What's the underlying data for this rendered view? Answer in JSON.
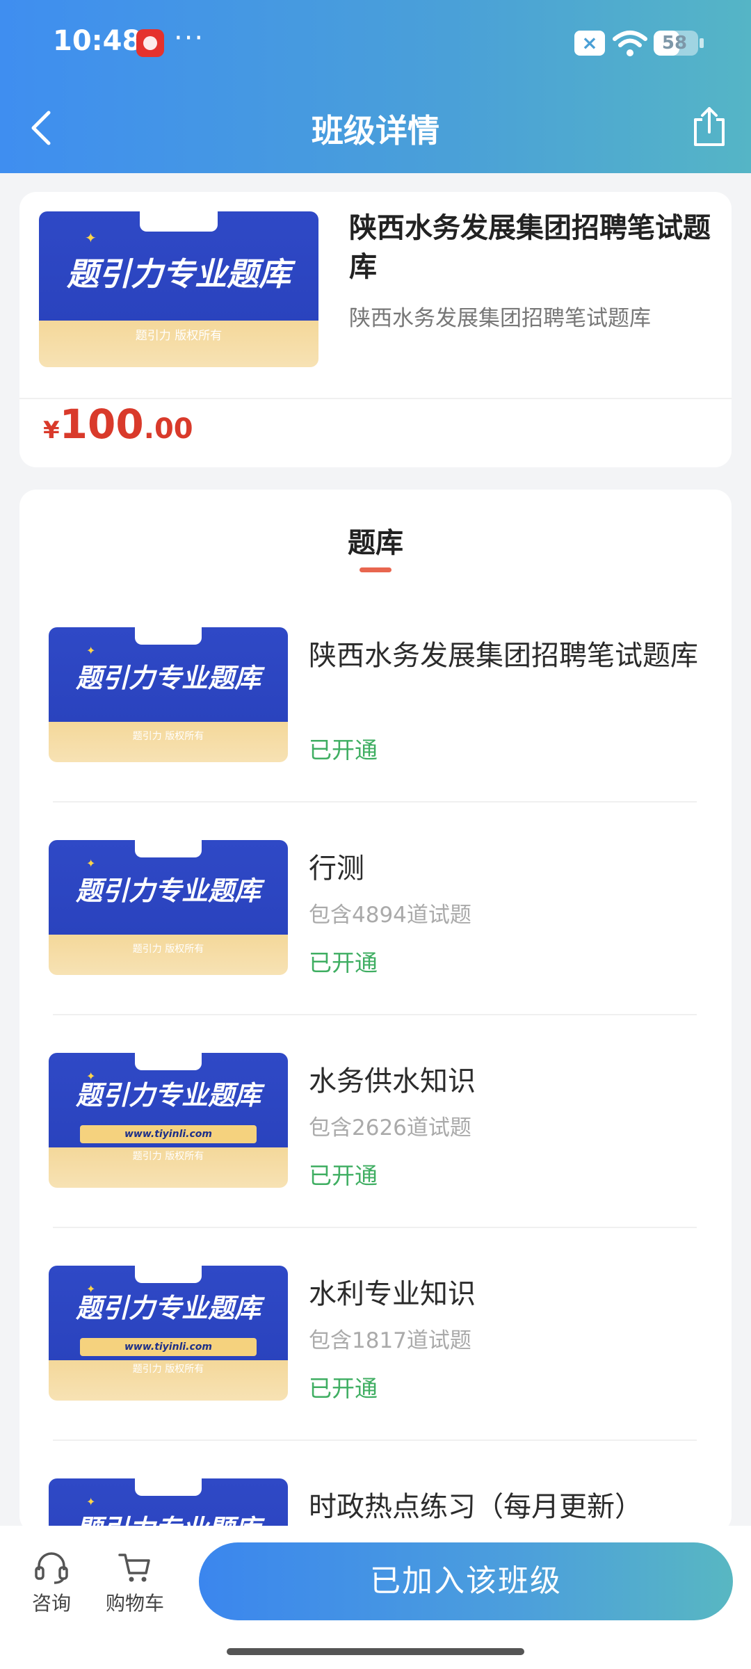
{
  "status_bar": {
    "time": "10:48",
    "more": "···",
    "battery": "58",
    "battery_level_percent": 58
  },
  "nav": {
    "title": "班级详情",
    "back_icon": "chevron-left-icon",
    "share_icon": "share-icon"
  },
  "thumbnail": {
    "title": "题引力专业题库",
    "brand": "题引力",
    "copyright": "题引力 版权所有",
    "url": "www.tiyinli.com"
  },
  "course": {
    "title": "陕西水务发展集团招聘笔试题库",
    "subtitle": "陕西水务发展集团招聘笔试题库",
    "price": {
      "currency": "¥",
      "integer": "100",
      "decimal": ".00"
    }
  },
  "section": {
    "title": "题库"
  },
  "banks": [
    {
      "name": "陕西水务发展集团招聘笔试题库",
      "count": "",
      "status": "已开通",
      "has_url": false
    },
    {
      "name": "行测",
      "count": "包含4894道试题",
      "status": "已开通",
      "has_url": false
    },
    {
      "name": "水务供水知识",
      "count": "包含2626道试题",
      "status": "已开通",
      "has_url": true
    },
    {
      "name": "水利专业知识",
      "count": "包含1817道试题",
      "status": "已开通",
      "has_url": true
    },
    {
      "name": "时政热点练习（每月更新）",
      "count": "",
      "status": "",
      "has_url": false
    }
  ],
  "bottom": {
    "consult": "咨询",
    "cart": "购物车",
    "join": "已加入该班级"
  },
  "colors": {
    "header_start": "#3f8ef0",
    "header_end": "#55b5c6",
    "price": "#d93a2b",
    "status_green": "#3fae62",
    "accent_underline": "#e8664f"
  }
}
